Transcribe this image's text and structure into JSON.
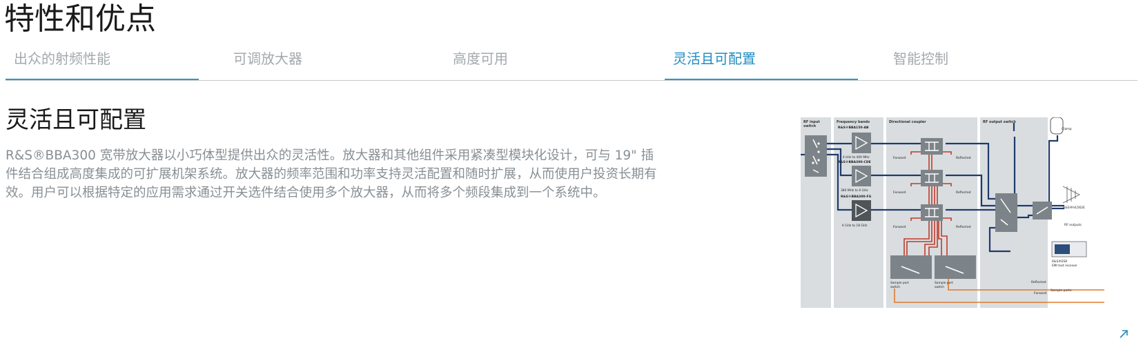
{
  "page_title": "特性和优点",
  "tabs": [
    {
      "label": "出众的射频性能"
    },
    {
      "label": "可调放大器"
    },
    {
      "label": "高度可用"
    },
    {
      "label": "灵活且可配置"
    },
    {
      "label": "智能控制"
    }
  ],
  "section": {
    "title": "灵活且可配置",
    "description": "R&S®BBA300 宽带放大器以小巧体型提供出众的灵活性。放大器和其他组件采用紧凑型模块化设计，可与 19\" 插件结合组成高度集成的可扩展机架系统。放大器的频率范围和功率支持灵活配置和随时扩展，从而使用户投资长期有效。用户可以根据特定的应用需求通过开关选件结合使用多个放大器，从而将多个频段集成到一个系统中。"
  },
  "diagram": {
    "col_rf_input_1": "RF input",
    "col_rf_input_2": "switch",
    "col_freq": "Frequency bands",
    "col_coupler": "Directional coupler",
    "col_rf_out": "RF output switch",
    "amp1_name": "R&S®BBA150-AB",
    "amp1_range": "4 kHz to 400 MHz",
    "amp2_name": "R&S®BBA300-CDE",
    "amp2_range": "380 MHz to 6 GHz",
    "amp3_name": "R&S®BBA300-FG",
    "amp3_range": "6 GHz to 18 GHz",
    "forward": "Forward",
    "reflected": "Reflected",
    "sample_switch_1": "Sample port",
    "sample_switch_2": "switch",
    "clamp": "Clamp",
    "antenna": "R&S®HL562E",
    "rf_outputs": "RF outputs",
    "receiver_1": "R&S®ESR",
    "receiver_2": "EMI test receiver",
    "reflected_label": "Reflected",
    "forward_label": "Forward",
    "sample_ports": "Sample ports",
    "colors": {
      "navy": "#1f3a6b",
      "red": "#c0392b",
      "orange": "#e07a2e",
      "panel": "#d9dde0",
      "box": "#7d8489"
    }
  }
}
